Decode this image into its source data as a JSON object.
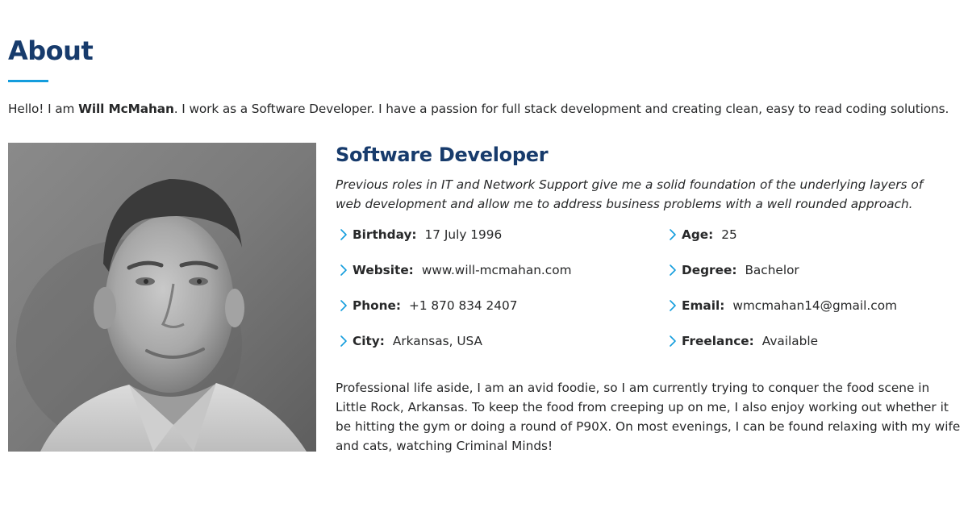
{
  "section": {
    "title": "About"
  },
  "intro": {
    "prefix": "Hello! I am ",
    "name": "Will McMahan",
    "suffix": ". I work as a Software Developer. I have a passion for full stack development and creating clean, easy to read coding solutions."
  },
  "profile": {
    "photo_icon": "profile-photo",
    "role_title": "Software Developer",
    "role_description": "Previous roles in IT and Network Support give me a solid foundation of the underlying layers of web development and allow me to address business problems with a well rounded approach.",
    "facts_left": [
      {
        "label": "Birthday:",
        "value": "17 July 1996"
      },
      {
        "label": "Website:",
        "value": "www.will-mcmahan.com"
      },
      {
        "label": "Phone:",
        "value": "+1 870 834 2407"
      },
      {
        "label": "City:",
        "value": "Arkansas, USA"
      }
    ],
    "facts_right": [
      {
        "label": "Age:",
        "value": "25"
      },
      {
        "label": "Degree:",
        "value": "Bachelor"
      },
      {
        "label": "Email:",
        "value": "wmcmahan14@gmail.com"
      },
      {
        "label": "Freelance:",
        "value": "Available"
      }
    ],
    "bio": "Professional life aside, I am an avid foodie, so I am currently trying to conquer the food scene in Little Rock, Arkansas. To keep the food from creeping up on me, I also enjoy working out whether it be hitting the gym or doing a round of P90X. On most evenings, I can be found relaxing with my wife and cats, watching Criminal Minds!"
  },
  "colors": {
    "heading": "#173b6c",
    "accent": "#149ddd",
    "text": "#272829"
  }
}
